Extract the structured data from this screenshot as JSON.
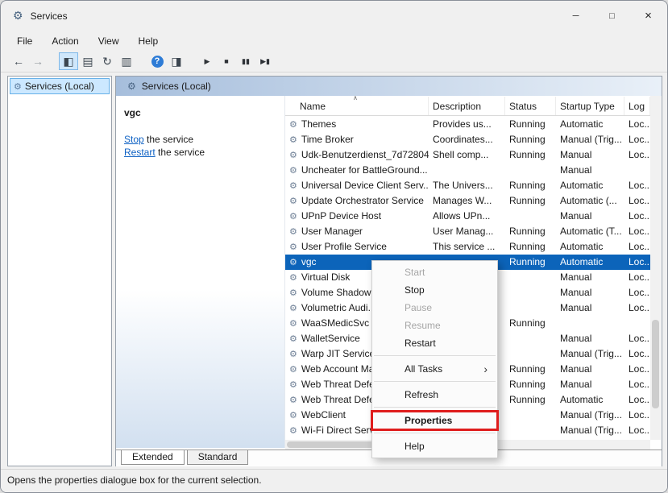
{
  "window": {
    "title": "Services",
    "controls": {
      "minimize": "─",
      "maximize": "□",
      "close": "×"
    }
  },
  "menubar": {
    "items": [
      "File",
      "Action",
      "View",
      "Help"
    ]
  },
  "toolbar": {
    "buttons": [
      {
        "name": "back",
        "glyph": "←"
      },
      {
        "name": "forward",
        "glyph": "→",
        "dim": true
      },
      {
        "name": "show-console-tree",
        "glyph": "◧",
        "pressed": true,
        "gap": 14
      },
      {
        "name": "properties",
        "glyph": "▤"
      },
      {
        "name": "refresh",
        "glyph": "↻"
      },
      {
        "name": "export-list",
        "glyph": "▥"
      },
      {
        "name": "help",
        "glyph": "?",
        "kind": "help",
        "gap": 14
      },
      {
        "name": "show-action-pane",
        "glyph": "◨"
      },
      {
        "name": "start-service",
        "glyph": "▶",
        "kind": "media",
        "gap": 14
      },
      {
        "name": "stop-service",
        "glyph": "■",
        "kind": "media"
      },
      {
        "name": "pause-service",
        "glyph": "▮▮",
        "kind": "media"
      },
      {
        "name": "restart-service",
        "glyph": "▶▮",
        "kind": "media"
      }
    ]
  },
  "tree": {
    "root_label": "Services (Local)"
  },
  "main": {
    "header_label": "Services (Local)",
    "info": {
      "service_name": "vgc",
      "stop_link": "Stop",
      "stop_rest": "the service",
      "restart_link": "Restart",
      "restart_rest": "the service"
    },
    "table": {
      "columns": [
        "Name",
        "Description",
        "Status",
        "Startup Type",
        "Log"
      ],
      "rows": [
        {
          "name": "Themes",
          "description": "Provides us...",
          "status": "Running",
          "startup": "Automatic",
          "logon": "Loc...",
          "selected": false
        },
        {
          "name": "Time Broker",
          "description": "Coordinates...",
          "status": "Running",
          "startup": "Manual (Trig...",
          "logon": "Loc...",
          "selected": false
        },
        {
          "name": "Udk-Benutzerdienst_7d72804",
          "description": "Shell comp...",
          "status": "Running",
          "startup": "Manual",
          "logon": "Loc...",
          "selected": false
        },
        {
          "name": "Uncheater for BattleGround...",
          "description": "",
          "status": "",
          "startup": "Manual",
          "logon": "",
          "selected": false
        },
        {
          "name": "Universal Device Client Serv...",
          "description": "The Univers...",
          "status": "Running",
          "startup": "Automatic",
          "logon": "Loc...",
          "selected": false
        },
        {
          "name": "Update Orchestrator Service",
          "description": "Manages W...",
          "status": "Running",
          "startup": "Automatic (...",
          "logon": "Loc...",
          "selected": false
        },
        {
          "name": "UPnP Device Host",
          "description": "Allows UPn...",
          "status": "",
          "startup": "Manual",
          "logon": "Loc...",
          "selected": false
        },
        {
          "name": "User Manager",
          "description": "User Manag...",
          "status": "Running",
          "startup": "Automatic (T...",
          "logon": "Loc...",
          "selected": false
        },
        {
          "name": "User Profile Service",
          "description": "This service ...",
          "status": "Running",
          "startup": "Automatic",
          "logon": "Loc...",
          "selected": false
        },
        {
          "name": "vgc",
          "description": "",
          "status": "Running",
          "startup": "Automatic",
          "logon": "Loc...",
          "selected": true
        },
        {
          "name": "Virtual Disk",
          "description": "",
          "status": "",
          "startup": "Manual",
          "logon": "Loc...",
          "selected": false
        },
        {
          "name": "Volume Shadow...",
          "description": "",
          "status": "",
          "startup": "Manual",
          "logon": "Loc...",
          "selected": false
        },
        {
          "name": "Volumetric Audi...",
          "description": "",
          "status": "",
          "startup": "Manual",
          "logon": "Loc...",
          "selected": false
        },
        {
          "name": "WaaSMedicSvc",
          "description": "",
          "status": "Running",
          "startup": "",
          "logon": "",
          "selected": false
        },
        {
          "name": "WalletService",
          "description": "",
          "status": "",
          "startup": "Manual",
          "logon": "Loc...",
          "selected": false
        },
        {
          "name": "Warp JIT Service",
          "description": "",
          "status": "",
          "startup": "Manual (Trig...",
          "logon": "Loc...",
          "selected": false
        },
        {
          "name": "Web Account Ma...",
          "description": "",
          "status": "Running",
          "startup": "Manual",
          "logon": "Loc...",
          "selected": false
        },
        {
          "name": "Web Threat Defe...",
          "description": "",
          "status": "Running",
          "startup": "Manual",
          "logon": "Loc...",
          "selected": false
        },
        {
          "name": "Web Threat Defe...",
          "description": "",
          "status": "Running",
          "startup": "Automatic",
          "logon": "Loc...",
          "selected": false
        },
        {
          "name": "WebClient",
          "description": "",
          "status": "",
          "startup": "Manual (Trig...",
          "logon": "Loc...",
          "selected": false
        },
        {
          "name": "Wi-Fi Direct Serv...",
          "description": "",
          "status": "",
          "startup": "Manual (Trig...",
          "logon": "Loc...",
          "selected": false
        }
      ]
    },
    "tabs": [
      {
        "label": "Extended",
        "active": true
      },
      {
        "label": "Standard",
        "active": false
      }
    ]
  },
  "context_menu": {
    "items": [
      {
        "label": "Start",
        "disabled": true
      },
      {
        "label": "Stop"
      },
      {
        "label": "Pause",
        "disabled": true
      },
      {
        "label": "Resume",
        "disabled": true
      },
      {
        "label": "Restart"
      },
      {
        "type": "separator"
      },
      {
        "label": "All Tasks",
        "submenu": true
      },
      {
        "type": "separator"
      },
      {
        "label": "Refresh"
      },
      {
        "type": "separator"
      },
      {
        "label": "Properties",
        "bold": true,
        "highlighted": true
      },
      {
        "type": "separator"
      },
      {
        "label": "Help"
      }
    ]
  },
  "statusbar": {
    "text": "Opens the properties dialogue box for the current selection."
  },
  "colors": {
    "selection": "#0c64ba",
    "highlight_box": "#df1d1d",
    "link": "#0f62c4"
  }
}
